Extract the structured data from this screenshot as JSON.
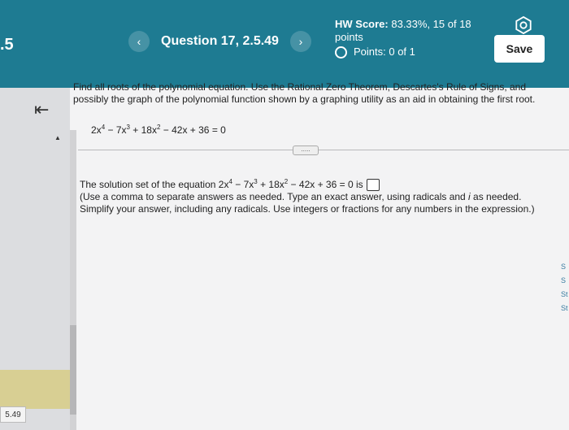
{
  "header": {
    "section": ".5",
    "question_title": "Question 17, 2.5.49",
    "prev_glyph": "‹",
    "next_glyph": "›",
    "hw_label": "HW Score:",
    "hw_value": "83.33%, 15 of 18",
    "hw_unit": "points",
    "points_label": "Points: 0 of 1",
    "save_label": "Save"
  },
  "sidebar": {
    "back_glyph": "⇤",
    "bottom_tab": "5.49"
  },
  "question": {
    "instructions": "Find all roots of the polynomial equation. Use the Rational Zero Theorem, Descartes's Rule of Signs, and possibly the graph of the polynomial function shown by a graphing utility as an aid in obtaining the first root.",
    "eq_prefix": "2x",
    "eq_t1": "4",
    "eq_m1": " − 7x",
    "eq_t2": "3",
    "eq_m2": " + 18x",
    "eq_t3": "2",
    "eq_rest": " − 42x + 36 = 0",
    "dots": "....."
  },
  "answer": {
    "lead": "The solution set of the equation 2x",
    "p1": "4",
    "m1": " − 7x",
    "p2": "3",
    "m2": " + 18x",
    "p3": "2",
    "tail": " − 42x + 36 = 0 is",
    "note_part1": "(Use a comma to separate answers as needed. Type an exact answer, using radicals and ",
    "note_italic": "i",
    "note_part2": " as needed. Simplify your answer, including any radicals. Use integers or fractions for any numbers in the expression.)"
  },
  "right_edge": [
    "S",
    "S",
    "St",
    "St"
  ],
  "colors": {
    "header_bg": "#1e7b92",
    "highlight": "#d8cf93"
  }
}
